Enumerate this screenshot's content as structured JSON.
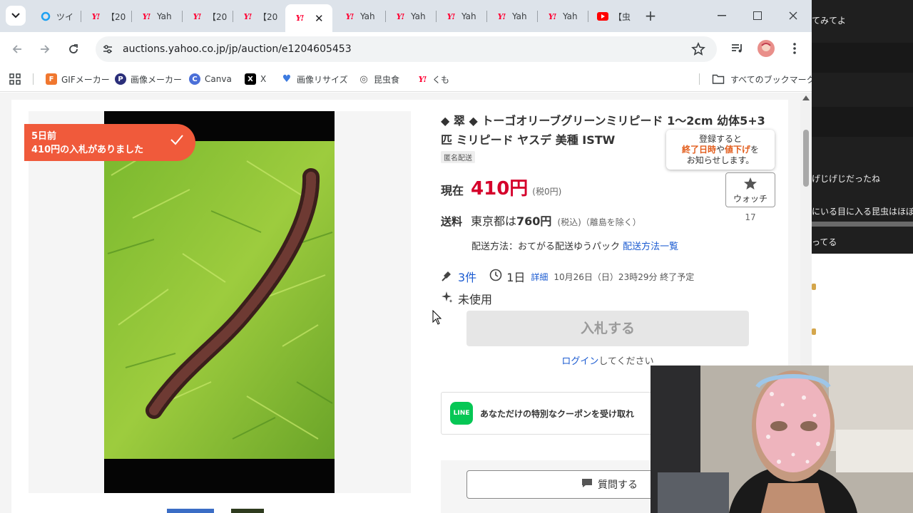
{
  "chat": {
    "messages": [
      {
        "text": "てみてよ"
      },
      {
        "text": "げじげじだったね"
      },
      {
        "text": "にいる目に入る昆虫はほぼ食"
      },
      {
        "text": "ってる"
      }
    ]
  },
  "browser": {
    "tabs": [
      {
        "label": "ツイ",
        "icon": "circle-icon"
      },
      {
        "label": "【20",
        "icon": "yahoo-icon"
      },
      {
        "label": "Yah",
        "icon": "yahoo-icon"
      },
      {
        "label": "【20",
        "icon": "yahoo-icon"
      },
      {
        "label": "【20",
        "icon": "yahoo-icon"
      },
      {
        "label": "",
        "icon": "yahoo-icon",
        "active": true
      },
      {
        "label": "Yah",
        "icon": "yahoo-icon"
      },
      {
        "label": "Yah",
        "icon": "yahoo-icon"
      },
      {
        "label": "Yah",
        "icon": "yahoo-icon"
      },
      {
        "label": "Yah",
        "icon": "yahoo-icon"
      },
      {
        "label": "Yah",
        "icon": "yahoo-icon"
      },
      {
        "label": "【虫",
        "icon": "youtube-icon"
      }
    ],
    "yahoo_logo": "Y!",
    "url": "auctions.yahoo.co.jp/jp/auction/e1204605453",
    "bookmarks": [
      {
        "label": "GIFメーカー",
        "icon": "gif-maker-icon",
        "color": "#f0772f",
        "glyph": "F"
      },
      {
        "label": "画像メーカー",
        "icon": "image-maker-icon",
        "color": "#2b2f7a",
        "glyph": "P"
      },
      {
        "label": "Canva",
        "icon": "canva-icon",
        "color": "#4b6fd8",
        "glyph": "C"
      },
      {
        "label": "X",
        "icon": "x-icon",
        "color": "#000000",
        "glyph": "X"
      },
      {
        "label": "画像リサイズ",
        "icon": "resize-icon",
        "color": "#3d7be0",
        "glyph": "♥"
      },
      {
        "label": "昆虫食",
        "icon": "insect-food-icon",
        "color": "#555555",
        "glyph": "◎"
      },
      {
        "label": "くも",
        "icon": "yahoo-icon",
        "color": "#ffffff",
        "glyph": "Y!"
      }
    ],
    "all_bookmarks": "すべてのブックマーク"
  },
  "auction": {
    "badge_line1": "5日前",
    "badge_line2": "410円の入札がありました",
    "title": "◆ 翠 ◆ トーゴオリーブグリーンミリピード 1～2cm 幼体5+3匹 ミリピード ヤスデ 美種 ISTW",
    "tag": "匿名配送",
    "tooltip": {
      "line1": "登録すると",
      "hl1": "終了日時",
      "mid": "や",
      "hl2": "値下げ",
      "tail": "を",
      "line3": "お知らせします。"
    },
    "watch_label": "ウォッチ",
    "watch_count": "17",
    "price_label": "現在",
    "price": "410円",
    "tax": "(税0円)",
    "ship_label": "送料",
    "ship_prefix": "東京都は",
    "ship_amount": "760円",
    "ship_note": "(税込)（離島を除く）",
    "method_text": "配送方法：おてがる配送ゆうパック",
    "method_link": "配送方法一覧",
    "bids": "3件",
    "days_left": "1日",
    "detail": "詳細",
    "end_time": "10月26日（日）23時29分 終了予定",
    "condition": "未使用",
    "bid_button": "入札する",
    "login_link": "ログイン",
    "login_tail": "してください",
    "line_text": "あなただけの特別なクーポンを受け取れ",
    "line_icon": "LINE",
    "question_button": "質問する"
  }
}
